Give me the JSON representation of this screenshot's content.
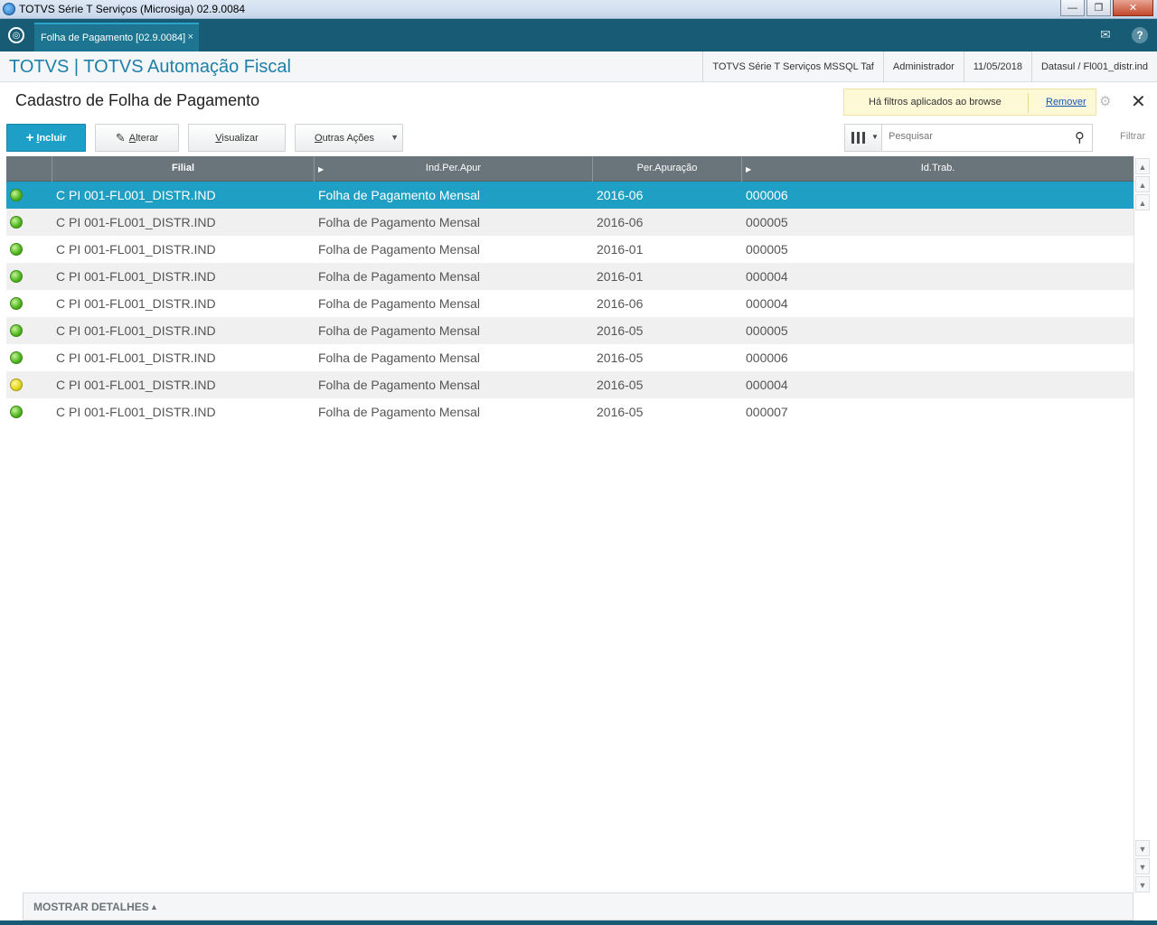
{
  "window": {
    "title": "TOTVS Série T Serviços (Microsiga) 02.9.0084",
    "controls": {
      "minimize": "—",
      "restore": "❐",
      "close": "✕"
    }
  },
  "app_tabbar": {
    "logo_glyph": "◎",
    "tab_label": "Folha de Pagamento [02.9.0084]",
    "tab_close": "×",
    "mail_glyph": "✉",
    "help_glyph": "?"
  },
  "header": {
    "app_name": "TOTVS | TOTVS Automação Fiscal",
    "environment": "TOTVS Série T Serviços MSSQL Taf",
    "user": "Administrador",
    "date": "11/05/2018",
    "company": "Datasul / Fl001_distr.ind"
  },
  "page": {
    "title": "Cadastro de Folha de Pagamento",
    "filter_notice": "Há filtros aplicados ao browse",
    "filter_remove": "Remover",
    "gear_glyph": "⚙",
    "close_glyph": "✕"
  },
  "toolbar": {
    "incluir": "Incluir",
    "incluir_glyph": "+",
    "alterar": "Alterar",
    "alterar_glyph": "✎",
    "visualizar": "Visualizar",
    "outras_acoes": "Outras Ações",
    "outras_caret": "▼",
    "search_placeholder": "Pesquisar",
    "search_glyph": "⚲",
    "col_dd_glyph": "▼",
    "filtrar": "Filtrar"
  },
  "grid": {
    "header_arrow": "▶",
    "columns": {
      "filial": "Filial",
      "ind_per_apur": "Ind.Per.Apur",
      "per_apuracao": "Per.Apuração",
      "id_trab": "Id.Trab."
    },
    "rows": [
      {
        "status": "green",
        "filial": "C PI 001-FL001_DISTR.IND",
        "ind": "Folha de Pagamento Mensal",
        "per": "2016-06",
        "id": "000006"
      },
      {
        "status": "green",
        "filial": "C PI 001-FL001_DISTR.IND",
        "ind": "Folha de Pagamento Mensal",
        "per": "2016-06",
        "id": "000005"
      },
      {
        "status": "green",
        "filial": "C PI 001-FL001_DISTR.IND",
        "ind": "Folha de Pagamento Mensal",
        "per": "2016-01",
        "id": "000005"
      },
      {
        "status": "green",
        "filial": "C PI 001-FL001_DISTR.IND",
        "ind": "Folha de Pagamento Mensal",
        "per": "2016-01",
        "id": "000004"
      },
      {
        "status": "green",
        "filial": "C PI 001-FL001_DISTR.IND",
        "ind": "Folha de Pagamento Mensal",
        "per": "2016-06",
        "id": "000004"
      },
      {
        "status": "green",
        "filial": "C PI 001-FL001_DISTR.IND",
        "ind": "Folha de Pagamento Mensal",
        "per": "2016-05",
        "id": "000005"
      },
      {
        "status": "green",
        "filial": "C PI 001-FL001_DISTR.IND",
        "ind": "Folha de Pagamento Mensal",
        "per": "2016-05",
        "id": "000006"
      },
      {
        "status": "yellow",
        "filial": "C PI 001-FL001_DISTR.IND",
        "ind": "Folha de Pagamento Mensal",
        "per": "2016-05",
        "id": "000004"
      },
      {
        "status": "green",
        "filial": "C PI 001-FL001_DISTR.IND",
        "ind": "Folha de Pagamento Mensal",
        "per": "2016-05",
        "id": "000007"
      }
    ],
    "selected_row": 0
  },
  "scrollbar": {
    "top": "▲",
    "page_up": "▲",
    "up": "▲",
    "down": "▼",
    "page_down": "▼",
    "bottom": "▼"
  },
  "footer": {
    "details_label": "MOSTRAR DETALHES",
    "details_caret": "▲"
  }
}
